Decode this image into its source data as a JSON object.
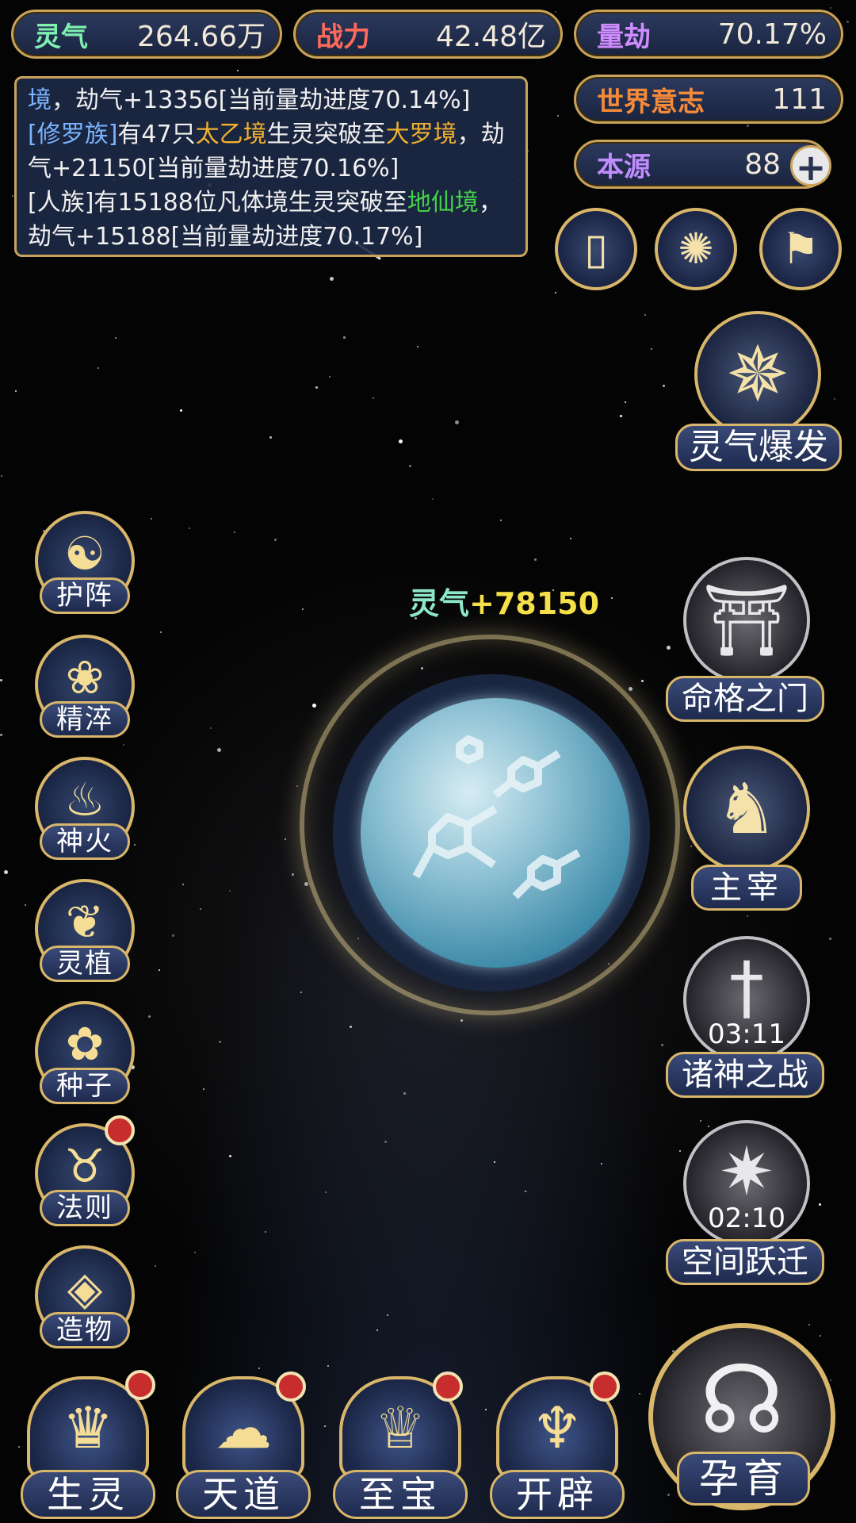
{
  "stats": {
    "lingqi": {
      "label": "灵气",
      "value": "264.66万"
    },
    "zhanli": {
      "label": "战力",
      "value": "42.48亿"
    },
    "liangjie": {
      "label": "量劫",
      "value": "70.17%"
    },
    "shijieyizhi": {
      "label": "世界意志",
      "value": "111"
    },
    "benyuan": {
      "label": "本源",
      "value": "88",
      "plus": "+"
    }
  },
  "log": {
    "line1": {
      "a": "境",
      "b": "，劫气+13356[当前量劫进度70.14%]"
    },
    "line2": {
      "a": "[修罗族]",
      "b": "有47只",
      "c": "太乙境",
      "d": "生灵突破至",
      "e": "大罗境",
      "f": "，劫气+21150[当前量劫进度70.16%]"
    },
    "line3": {
      "a": "[人族]有15188位凡体境生灵突破至",
      "b": "地仙境",
      "c": "，劫气+15188[当前量劫进度70.17%]"
    }
  },
  "gain_popup": {
    "label": "灵气",
    "value": "+78150"
  },
  "right_buttons": {
    "burst": "灵气爆发",
    "gate": "命格之门",
    "ruler": "主宰",
    "gods_war": {
      "label": "诸神之战",
      "timer": "03:11"
    },
    "space_jump": {
      "label": "空间跃迁",
      "timer": "02:10"
    },
    "breed": "孕育"
  },
  "left_buttons": [
    "护阵",
    "精淬",
    "神火",
    "灵植",
    "种子",
    "法则",
    "造物"
  ],
  "bottom_buttons": [
    "生灵",
    "天道",
    "至宝",
    "开辟"
  ],
  "icons": [
    "card-icon",
    "vortex-icon",
    "flag-icon",
    "sunburst-icon",
    "yin-yang-icon",
    "lotus-icon",
    "flame-icon",
    "plant-icon",
    "flower-icon",
    "beast-icon",
    "crystal-icon",
    "phoenix-icon",
    "cloud-swirl-icon",
    "treasure-icon",
    "wings-icon",
    "temple-icon",
    "dragon-icon",
    "sword-icon",
    "swirl-icon",
    "embryo-icon"
  ],
  "colors": {
    "gold": "#c9a35a",
    "panel": "#1e2a48",
    "badge": "#c82d2d"
  }
}
